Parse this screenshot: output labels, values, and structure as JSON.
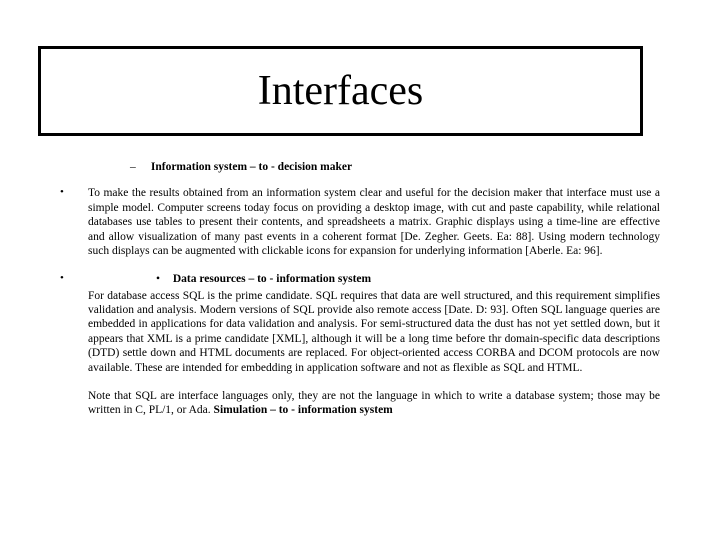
{
  "title": "Interfaces",
  "sub1": {
    "dash": "–",
    "label": "Information system – to - decision maker"
  },
  "para1": "To make the results obtained from an information system clear and useful for the decision maker that interface must use a simple model.  Computer screens today focus on providing a desktop image, with cut and paste capability, while relational databases use tables to present their contents, and spreadsheets a matrix. Graphic displays using a time-line are effective and allow visualization of many past events in a coherent format [De. Zegher. Geets. Ea: 88]. Using modern technology such displays can be augmented with clickable icons for expansion for underlying information [Aberle. Ea: 96].",
  "sub2": {
    "dot": "•",
    "label": "Data resources – to - information system"
  },
  "para2": "For database access SQL is the prime candidate. SQL requires that data are well structured, and this requirement simplifies validation and analysis. Modern versions of SQL provide also remote access [Date. D: 93].  Often SQL language queries are embedded in applications for data validation and analysis. For semi-structured data the dust has not yet settled down, but it appears that XML is a prime candidate [XML], although it will be a long time before thr domain-specific data descriptions (DTD) settle down and HTML documents are replaced.  For object-oriented access CORBA and DCOM protocols are now available. These are intended for embedding in application software and not as flexible as SQL and HTML.",
  "note_a": "Note that  SQL are interface languages only, they are not the language in which to write a database system; those may be written in C, PL/1, or Ada. ",
  "note_b": "Simulation – to - information system"
}
